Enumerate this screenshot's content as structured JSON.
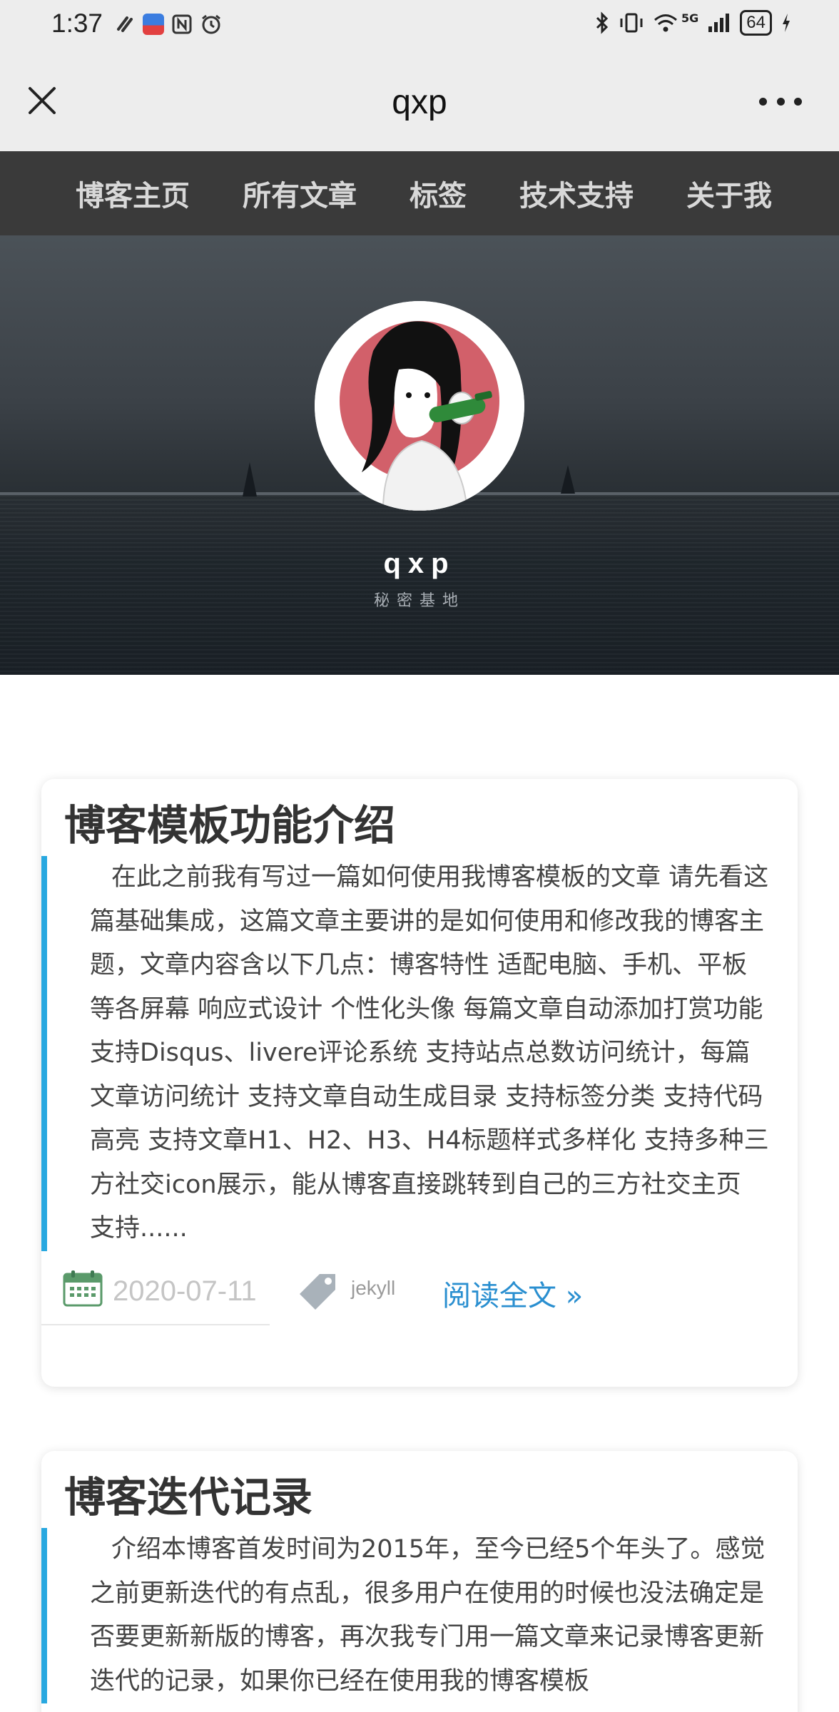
{
  "status_bar": {
    "time": "1:37",
    "network": "5G",
    "battery": "64",
    "left_icons": [
      "sync-icon",
      "app-icon",
      "nfc-icon",
      "alarm-icon"
    ],
    "right_icons": [
      "bluetooth-icon",
      "vibrate-icon",
      "wifi-icon",
      "signal-icon",
      "charging-icon"
    ]
  },
  "title_bar": {
    "title": "qxp"
  },
  "nav": {
    "items": [
      {
        "label": "博客主页"
      },
      {
        "label": "所有文章"
      },
      {
        "label": "标签"
      },
      {
        "label": "技术支持"
      },
      {
        "label": "关于我"
      }
    ]
  },
  "hero": {
    "name": "qxp",
    "subtitle": "秘密基地"
  },
  "posts": [
    {
      "title": "博客模板功能介绍",
      "excerpt": "在此之前我有写过一篇如何使用我博客模板的文章 请先看这篇基础集成，这篇文章主要讲的是如何使用和修改我的博客主题，文章内容含以下几点：博客特性 适配电脑、手机、平板等各屏幕 响应式设计 个性化头像 每篇文章自动添加打赏功能 支持Disqus、livere评论系统 支持站点总数访问统计，每篇文章访问统计 支持文章自动生成目录 支持标签分类 支持代码高亮 支持文章H1、H2、H3、H4标题样式多样化 支持多种三方社交icon展示，能从博客直接跳转到自己的三方社交主页 支持......",
      "date": "2020-07-11",
      "tag": "jekyll",
      "read_more": "阅读全文 »"
    },
    {
      "title": "博客迭代记录",
      "excerpt": "介绍本博客首发时间为2015年，至今已经5个年头了。感觉之前更新迭代的有点乱，很多用户在使用的时候也没法确定是否要更新新版的博客，再次我专门用一篇文章来记录博客更新迭代的记录，如果你已经在使用我的博客模板"
    }
  ],
  "colors": {
    "accent": "#28a8e0",
    "link": "#2a8fd0",
    "nav_bg": "#3a3a3a",
    "chrome_bg": "#ededed"
  }
}
